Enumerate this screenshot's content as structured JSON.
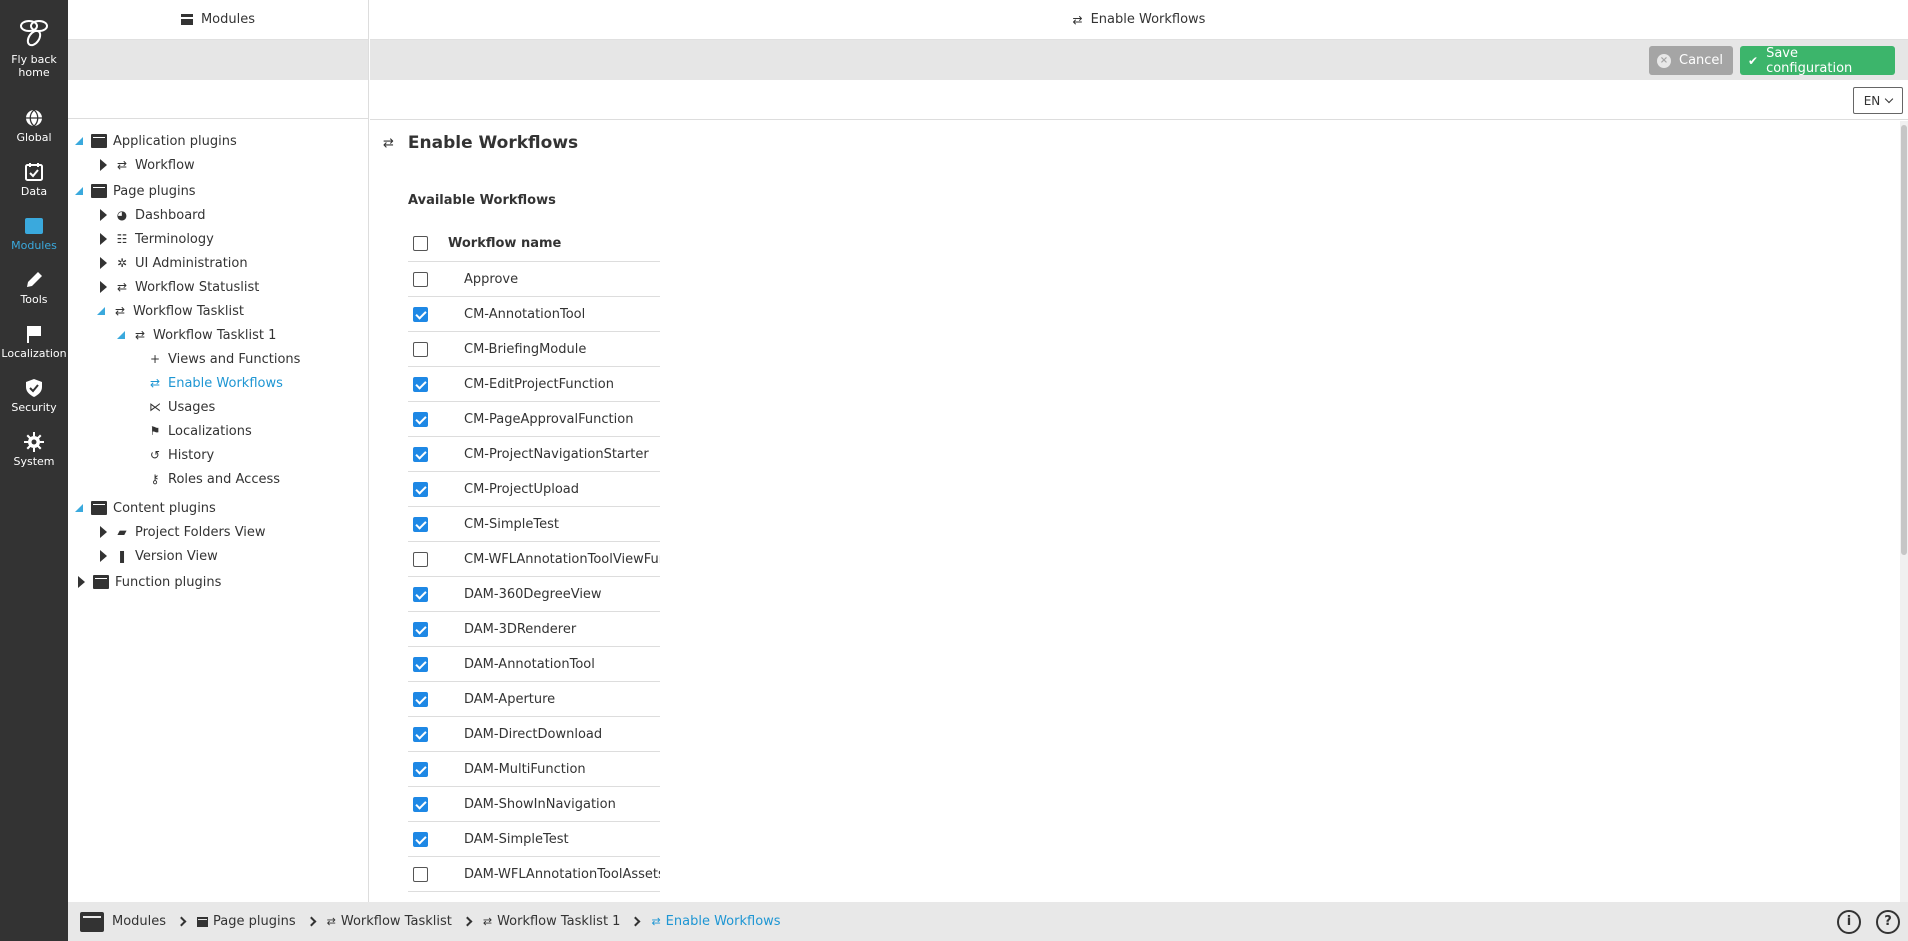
{
  "nav": {
    "items": [
      {
        "label_line1": "Fly back",
        "label_line2": "home",
        "icon": "bee-icon"
      },
      {
        "label": "Global",
        "icon": "globe-icon"
      },
      {
        "label": "Data",
        "icon": "data-icon"
      },
      {
        "label": "Modules",
        "icon": "modules-icon",
        "active": true
      },
      {
        "label": "Tools",
        "icon": "pencil-icon"
      },
      {
        "label": "Localization",
        "icon": "flag-icon"
      },
      {
        "label": "Security",
        "icon": "shield-icon"
      },
      {
        "label": "System",
        "icon": "gear-icon"
      }
    ]
  },
  "tree_panel": {
    "header_title": "Modules"
  },
  "tree": {
    "application_plugins": "Application plugins",
    "workflow": "Workflow",
    "page_plugins": "Page plugins",
    "dashboard": "Dashboard",
    "terminology": "Terminology",
    "ui_administration": "UI Administration",
    "workflow_statuslist": "Workflow Statuslist",
    "workflow_tasklist": "Workflow Tasklist",
    "workflow_tasklist_1": "Workflow Tasklist 1",
    "views_and_functions": "Views and Functions",
    "enable_workflows": "Enable Workflows",
    "usages": "Usages",
    "localizations": "Localizations",
    "history": "History",
    "roles_and_access": "Roles and Access",
    "content_plugins": "Content plugins",
    "project_folders_view": "Project Folders View",
    "version_view": "Version View",
    "function_plugins": "Function plugins"
  },
  "main": {
    "header_title": "Enable Workflows",
    "cancel_label": "Cancel",
    "save_label": "Save configuration",
    "language": "EN",
    "title": "Enable Workflows",
    "section_title": "Available Workflows",
    "column_header": "Workflow name",
    "workflows": [
      {
        "name": "Approve",
        "checked": false
      },
      {
        "name": "CM-AnnotationTool",
        "checked": true
      },
      {
        "name": "CM-BriefingModule",
        "checked": false
      },
      {
        "name": "CM-EditProjectFunction",
        "checked": true
      },
      {
        "name": "CM-PageApprovalFunction",
        "checked": true
      },
      {
        "name": "CM-ProjectNavigationStarter",
        "checked": true
      },
      {
        "name": "CM-ProjectUpload",
        "checked": true
      },
      {
        "name": "CM-SimpleTest",
        "checked": true
      },
      {
        "name": "CM-WFLAnnotationToolViewFunc",
        "checked": false
      },
      {
        "name": "DAM-360DegreeView",
        "checked": true
      },
      {
        "name": "DAM-3DRenderer",
        "checked": true
      },
      {
        "name": "DAM-AnnotationTool",
        "checked": true
      },
      {
        "name": "DAM-Aperture",
        "checked": true
      },
      {
        "name": "DAM-DirectDownload",
        "checked": true
      },
      {
        "name": "DAM-MultiFunction",
        "checked": true
      },
      {
        "name": "DAM-ShowInNavigation",
        "checked": true
      },
      {
        "name": "DAM-SimpleTest",
        "checked": true
      },
      {
        "name": "DAM-WFLAnnotationToolAssetsF",
        "checked": false
      }
    ]
  },
  "breadcrumb": {
    "items": [
      "Modules",
      "Page plugins",
      "Workflow Tasklist",
      "Workflow Tasklist 1",
      "Enable Workflows"
    ]
  },
  "footer": {
    "info_glyph": "i",
    "help_glyph": "?"
  },
  "colors": {
    "accent": "#3aa9dd",
    "save_green": "#3cb56b",
    "nav_dark": "#333333",
    "checkbox_blue": "#1e88e5"
  }
}
